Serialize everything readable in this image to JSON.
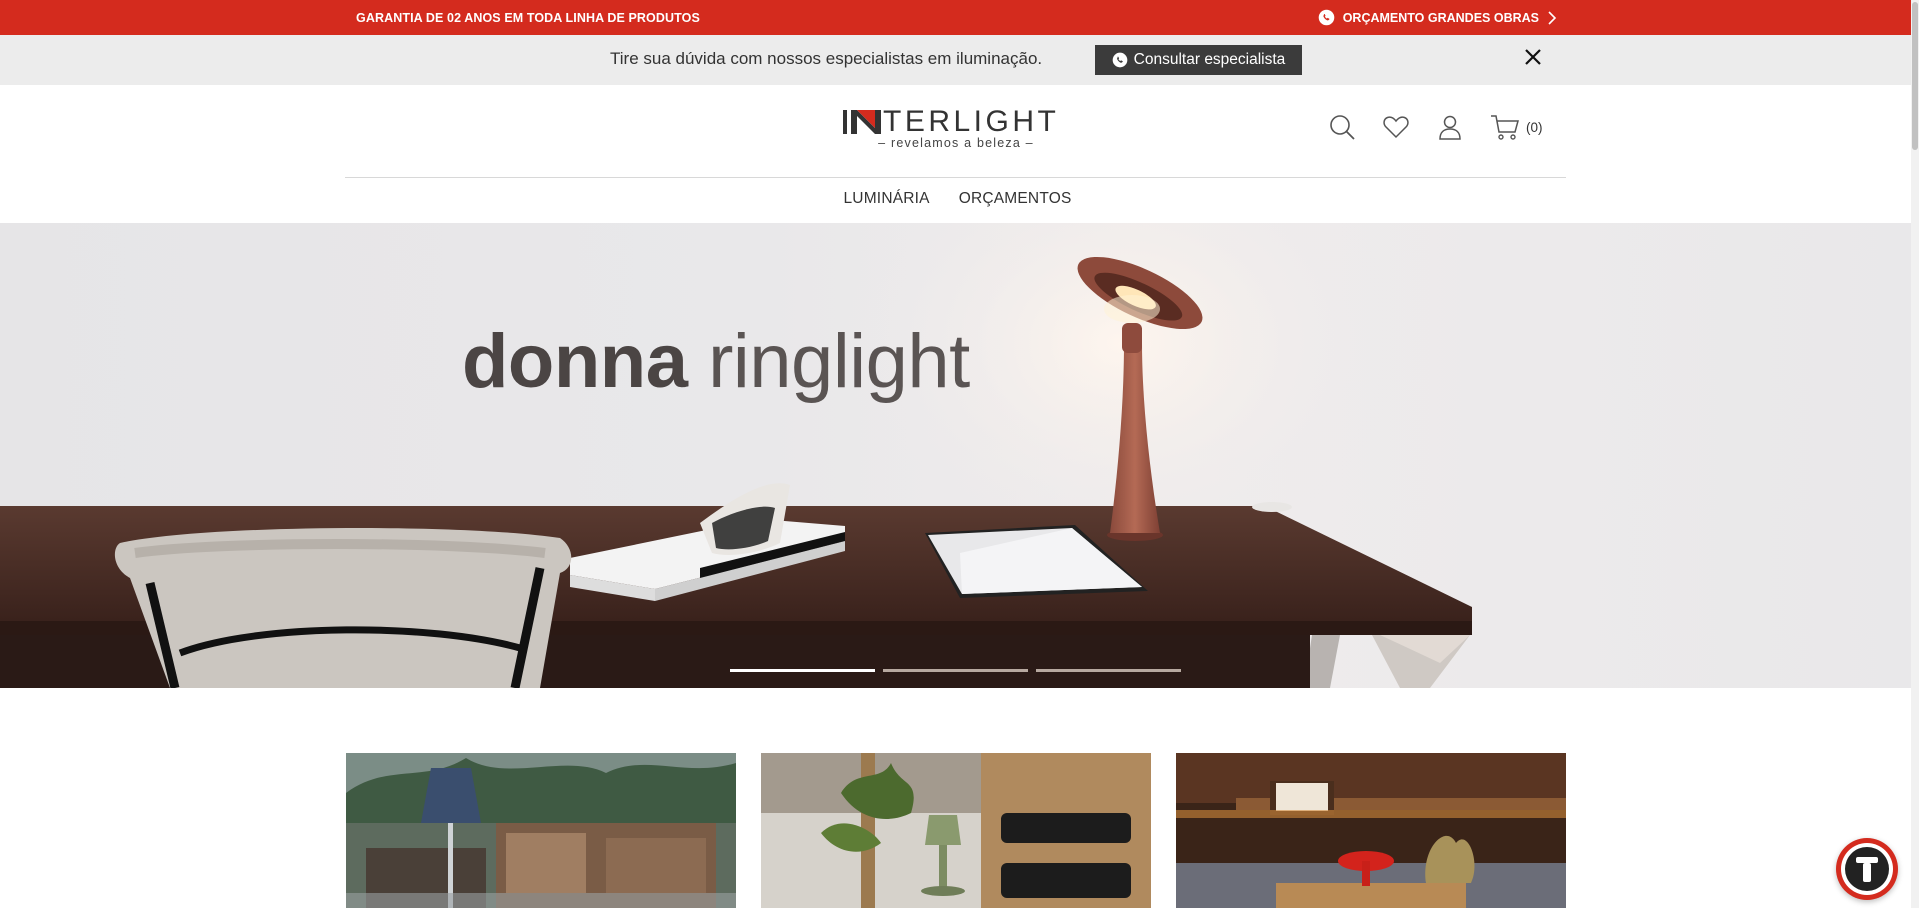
{
  "topbar": {
    "warranty_text": "GARANTIA DE 02 ANOS EM TODA LINHA DE PRODUTOS",
    "quote_link": "ORÇAMENTO GRANDES OBRAS",
    "quote_icon": "whatsapp-icon",
    "background": "#d42b1e"
  },
  "promo": {
    "message": "Tire sua dúvida com nossos especialistas em iluminação.",
    "button_label": "Consultar especialista",
    "button_icon": "whatsapp-icon",
    "close_icon": "close-icon"
  },
  "header": {
    "brand": "INTERLIGHT",
    "brand_rest": "TERLIGHT",
    "tagline": "– revelamos a beleza –",
    "icons": [
      "search-icon",
      "heart-icon",
      "user-icon",
      "cart-icon"
    ],
    "cart_count": "(0)"
  },
  "nav": {
    "items": [
      {
        "label": "LUMINÁRIA"
      },
      {
        "label": "ORÇAMENTOS"
      }
    ]
  },
  "hero": {
    "title_bold": "donna",
    "title_light": "ringlight",
    "slides": 3,
    "active_slide": 1
  },
  "cards": [
    {
      "name": "outdoor-lamp-card"
    },
    {
      "name": "table-lamp-card"
    },
    {
      "name": "mushroom-lamp-card"
    }
  ],
  "colors": {
    "accent": "#d42b1e",
    "dark_button": "#3b3b3b",
    "text": "#333333"
  }
}
